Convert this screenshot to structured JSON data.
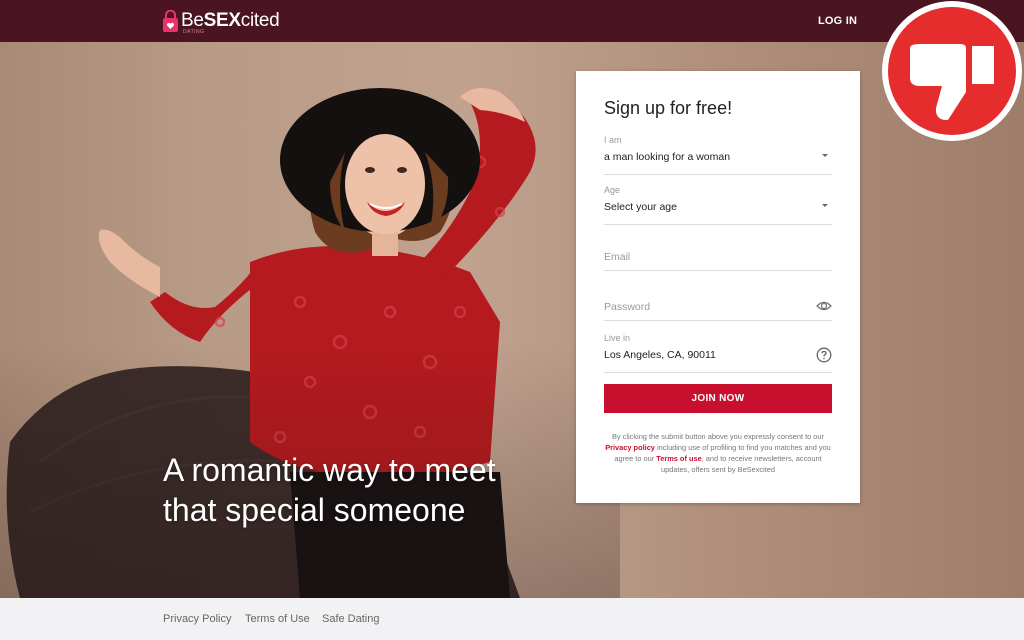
{
  "header": {
    "logo_text_a": "Be",
    "logo_text_b": "SEX",
    "logo_text_c": "cited",
    "logo_sub": "DATING",
    "login_label": "LOG IN"
  },
  "hero": {
    "headline_line1": "A romantic way to meet",
    "headline_line2": "that special someone"
  },
  "signup": {
    "title": "Sign up for free!",
    "iam_label": "I am",
    "iam_value": "a man looking for a woman",
    "age_label": "Age",
    "age_value": "Select your age",
    "email_placeholder": "Email",
    "password_placeholder": "Password",
    "livein_label": "Live in",
    "livein_value": "Los Angeles, CA, 90011",
    "join_label": "JOIN NOW",
    "disclaimer_1": "By clicking the submit button above you expressly consent to our",
    "privacy_link": "Privacy policy",
    "disclaimer_2": "including use of profiling to find you matches and you agree to our",
    "terms_link": "Terms of use",
    "disclaimer_3": ", and to receive newsletters, account updates, offers sent by BeSexcited"
  },
  "footer": {
    "links": [
      "Privacy Policy",
      "Terms of Use",
      "Safe Dating"
    ]
  },
  "colors": {
    "header_bg": "#4a1423",
    "accent": "#c8102e",
    "badge": "#e52d2d"
  },
  "icons": {
    "badge": "thumbs-down-icon",
    "password": "eye-icon",
    "location": "help-circle-icon",
    "select": "chevron-down-icon",
    "logo": "heart-lock-icon"
  }
}
